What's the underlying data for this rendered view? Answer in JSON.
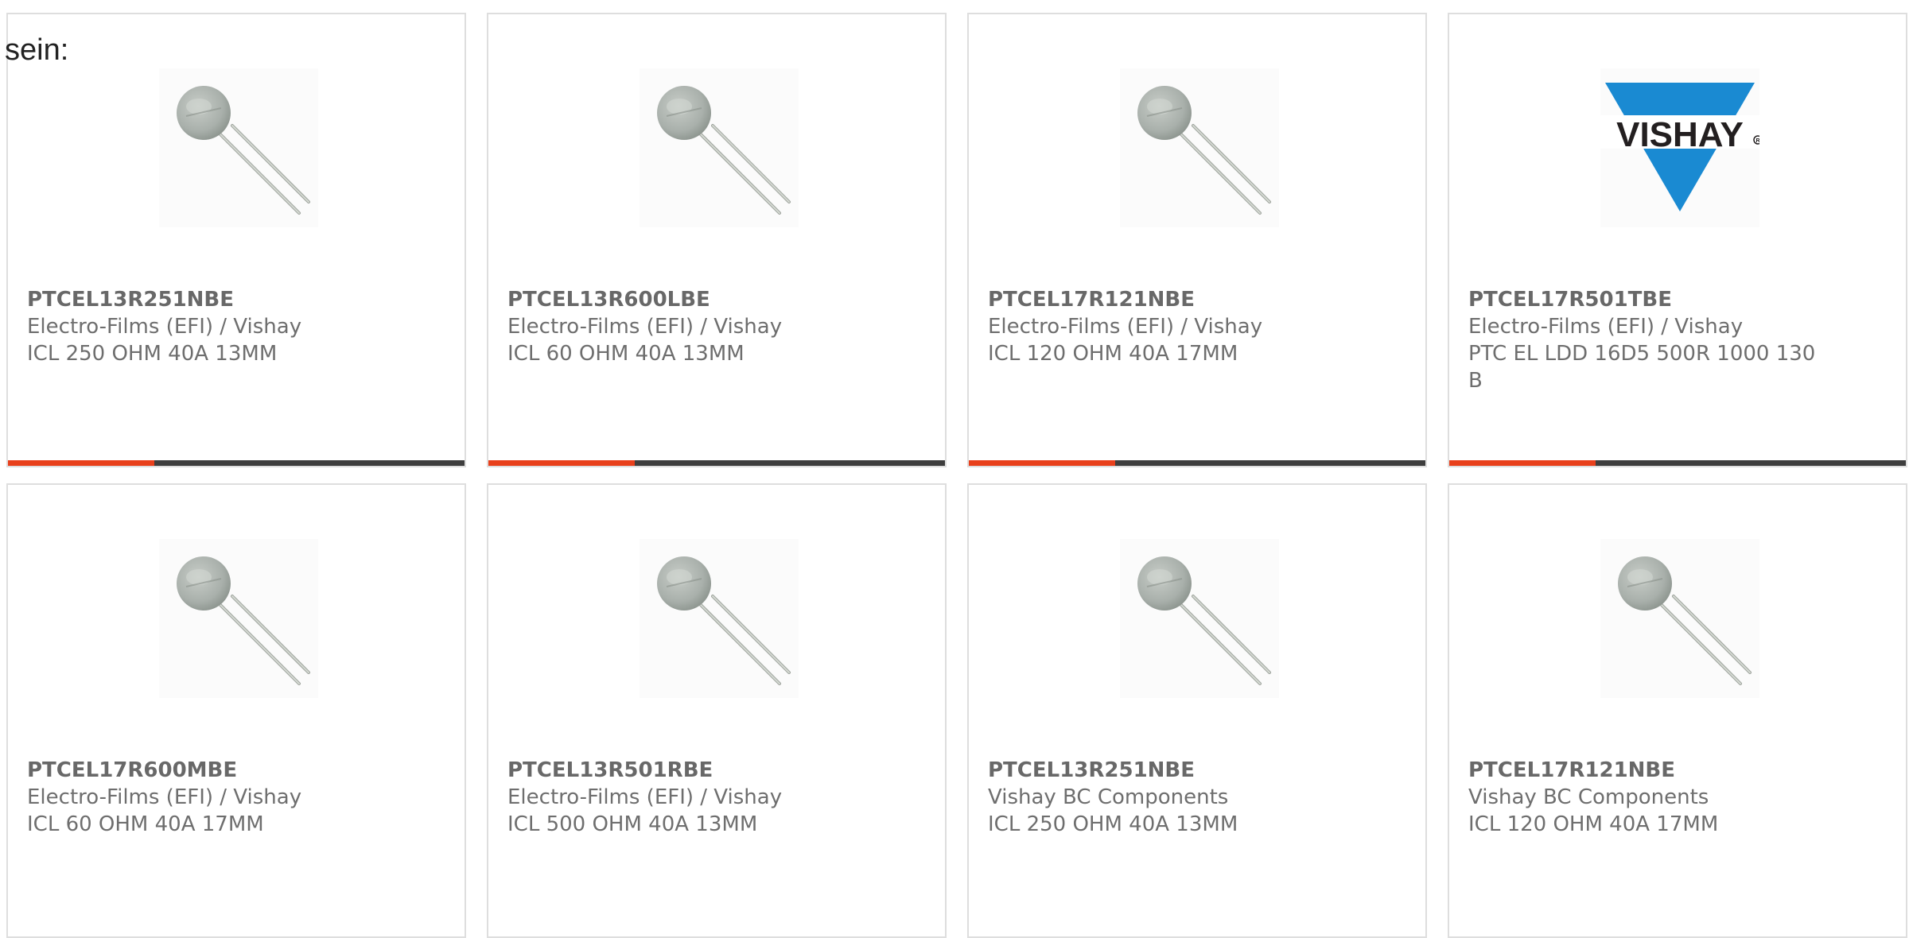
{
  "intro_text": "sein:",
  "accent_color": "#e8401c",
  "track_color": "#3e3e3e",
  "cards": [
    {
      "part_number": "PTCEL13R251NBE",
      "manufacturer": "Electro-Films (EFI) / Vishay",
      "description": "ICL 250 OHM 40A 13MM",
      "image": "thermistor-icon",
      "progress": 0.32
    },
    {
      "part_number": "PTCEL13R600LBE",
      "manufacturer": "Electro-Films (EFI) / Vishay",
      "description": "ICL 60 OHM 40A 13MM",
      "image": "thermistor-icon",
      "progress": 0.32
    },
    {
      "part_number": "PTCEL17R121NBE",
      "manufacturer": "Electro-Films (EFI) / Vishay",
      "description": "ICL 120 OHM 40A 17MM",
      "image": "thermistor-icon",
      "progress": 0.32
    },
    {
      "part_number": "PTCEL17R501TBE",
      "manufacturer": "Electro-Films (EFI) / Vishay",
      "description": "PTC EL LDD 16D5 500R 1000 130 B",
      "image": "vishay-logo",
      "logo_text": "VISHAY",
      "logo_color": "#1a8ad2",
      "progress": 0.32
    },
    {
      "part_number": "PTCEL17R600MBE",
      "manufacturer": "Electro-Films (EFI) / Vishay",
      "description": "ICL 60 OHM 40A 17MM",
      "image": "thermistor-icon"
    },
    {
      "part_number": "PTCEL13R501RBE",
      "manufacturer": "Electro-Films (EFI) / Vishay",
      "description": "ICL 500 OHM 40A 13MM",
      "image": "thermistor-icon"
    },
    {
      "part_number": "PTCEL13R251NBE",
      "manufacturer": "Vishay BC Components",
      "description": "ICL 250 OHM 40A 13MM",
      "image": "thermistor-icon"
    },
    {
      "part_number": "PTCEL17R121NBE",
      "manufacturer": "Vishay BC Components",
      "description": "ICL 120 OHM 40A 17MM",
      "image": "thermistor-icon"
    }
  ]
}
